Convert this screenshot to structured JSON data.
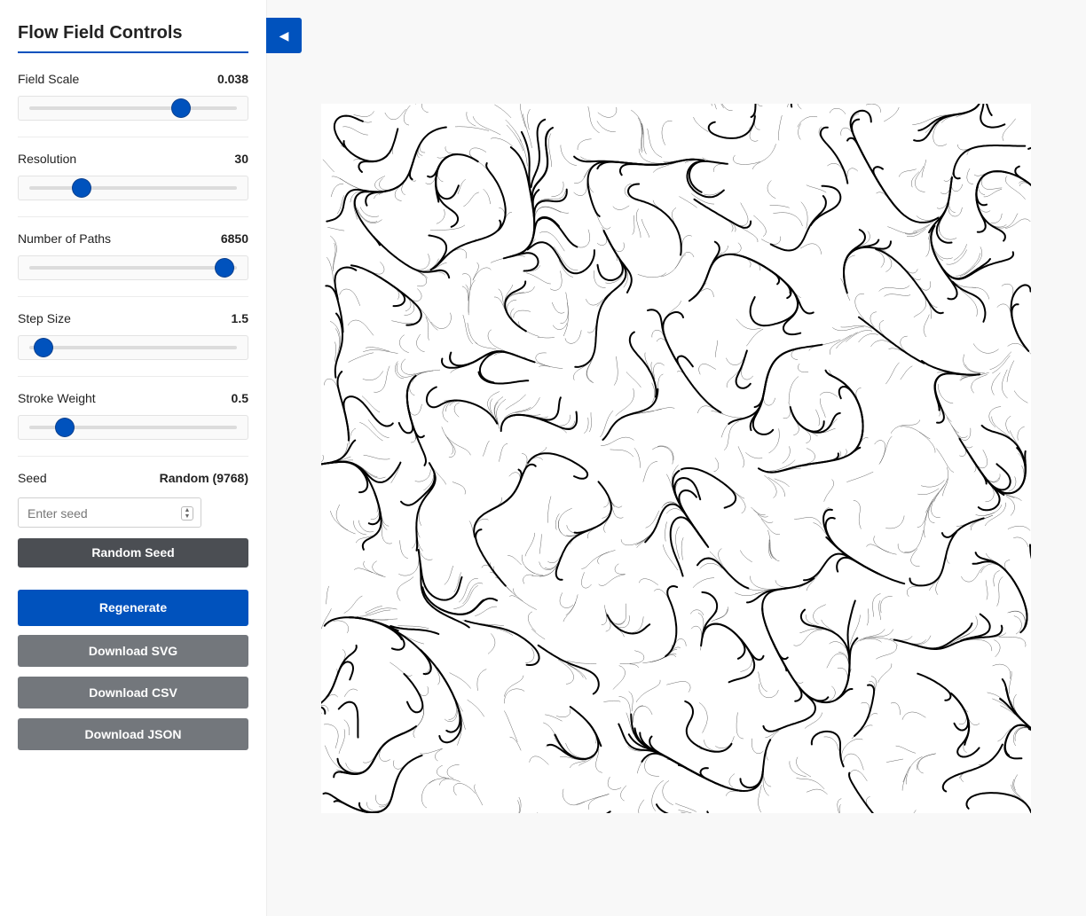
{
  "sidebar": {
    "title": "Flow Field Controls",
    "controls": [
      {
        "label": "Field Scale",
        "value": "0.038",
        "fraction": 0.73
      },
      {
        "label": "Resolution",
        "value": "30",
        "fraction": 0.25
      },
      {
        "label": "Number of Paths",
        "value": "6850",
        "fraction": 0.94
      },
      {
        "label": "Step Size",
        "value": "1.5",
        "fraction": 0.07
      },
      {
        "label": "Stroke Weight",
        "value": "0.5",
        "fraction": 0.17
      }
    ],
    "seed": {
      "label": "Seed",
      "value": "Random (9768)",
      "placeholder": "Enter seed"
    },
    "buttons": {
      "random_seed": "Random Seed",
      "regenerate": "Regenerate",
      "download_svg": "Download SVG",
      "download_csv": "Download CSV",
      "download_json": "Download JSON"
    }
  },
  "toggle_icon": "◀",
  "colors": {
    "accent": "#0052bd",
    "dark_button": "#4b4e53",
    "gray_button": "#73777c"
  },
  "icons": {
    "toggle": "collapse-left-icon",
    "spinner": "number-spinner-icon"
  }
}
